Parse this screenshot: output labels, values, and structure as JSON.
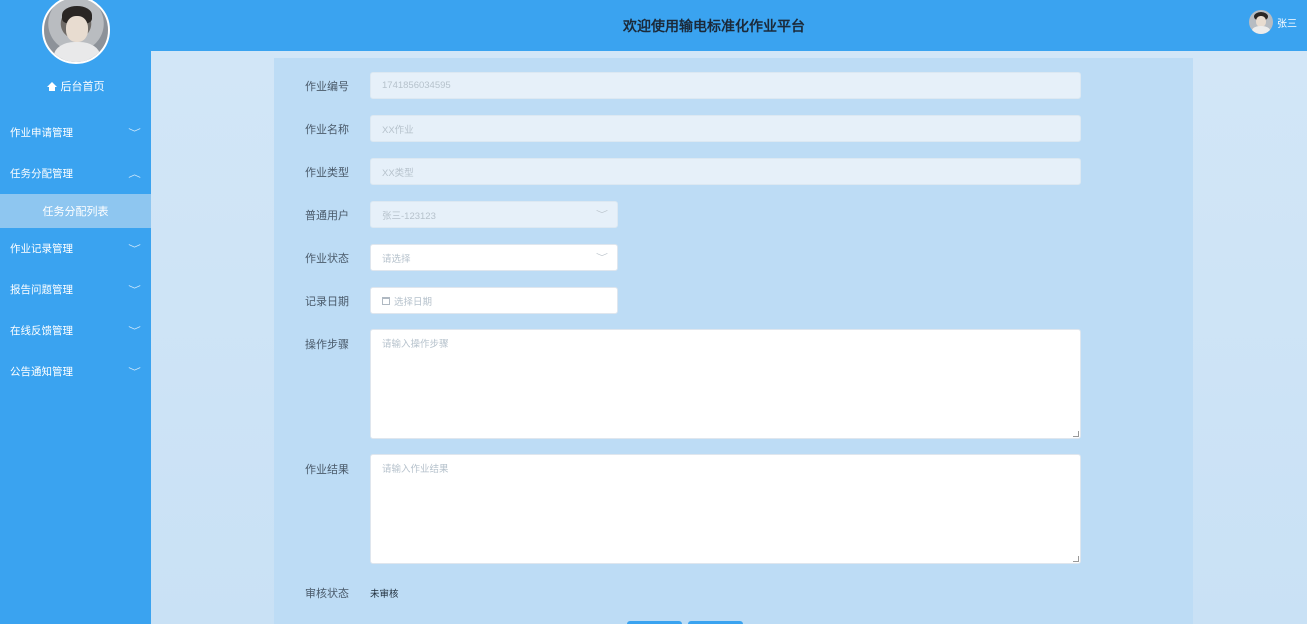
{
  "header": {
    "title": "欢迎使用输电标准化作业平台",
    "username": "张三"
  },
  "sidebar": {
    "home_label": "后台首页",
    "items": [
      {
        "label": "作业申请管理",
        "expanded": false
      },
      {
        "label": "任务分配管理",
        "expanded": true,
        "children": [
          {
            "label": "任务分配列表",
            "active": true
          }
        ]
      },
      {
        "label": "作业记录管理",
        "expanded": false
      },
      {
        "label": "报告问题管理",
        "expanded": false
      },
      {
        "label": "在线反馈管理",
        "expanded": false
      },
      {
        "label": "公告通知管理",
        "expanded": false
      }
    ],
    "chevron_down": "﹀",
    "chevron_up": "︿"
  },
  "form": {
    "job_number": {
      "label": "作业编号",
      "value": "1741856034595"
    },
    "job_name": {
      "label": "作业名称",
      "value": "XX作业"
    },
    "job_type": {
      "label": "作业类型",
      "value": "XX类型"
    },
    "user": {
      "label": "普通用户",
      "value": "张三-123123"
    },
    "job_status": {
      "label": "作业状态",
      "placeholder": "请选择"
    },
    "record_date": {
      "label": "记录日期",
      "placeholder": "选择日期"
    },
    "steps": {
      "label": "操作步骤",
      "placeholder": "请输入操作步骤"
    },
    "result": {
      "label": "作业结果",
      "placeholder": "请输入作业结果"
    },
    "review_status": {
      "label": "审核状态",
      "value": "未审核"
    }
  },
  "colors": {
    "primary": "#3aa3f0",
    "sub_active": "#8ec6f0",
    "content_bg": "#cfe4f6"
  },
  "icons": {
    "home": "home-icon",
    "calendar": "calendar-icon",
    "chevron": "chevron-down-icon"
  }
}
